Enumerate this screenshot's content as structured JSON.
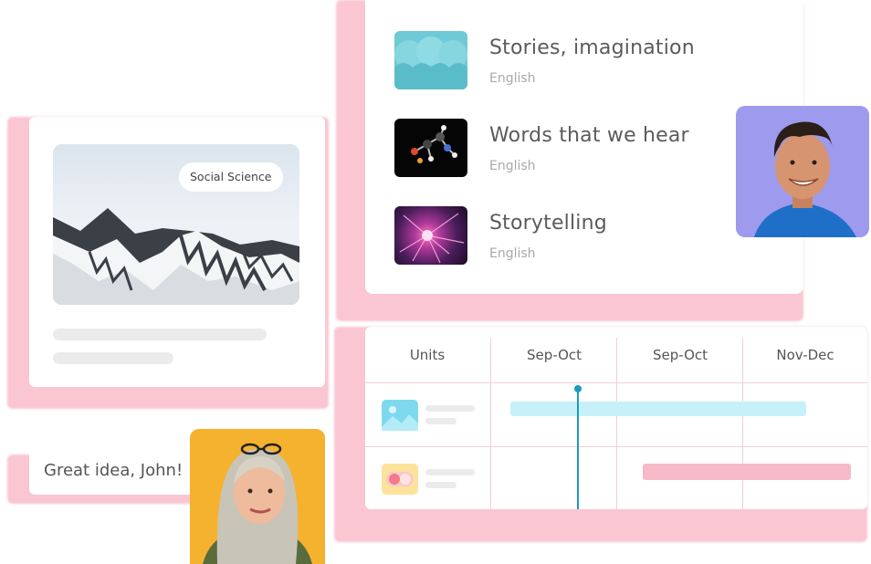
{
  "course_card": {
    "tag": "Social Science"
  },
  "lessons": [
    {
      "title": "Stories, imagination",
      "subject": "English"
    },
    {
      "title": "Words that we hear",
      "subject": "English"
    },
    {
      "title": "Storytelling",
      "subject": "English"
    }
  ],
  "timeline": {
    "columns": [
      "Units",
      "Sep-Oct",
      "Sep-Oct",
      "Nov-Dec"
    ]
  },
  "comment": {
    "text": "Great idea, John! 💡"
  },
  "colors": {
    "glow": "#f9c6d2",
    "bar_blue": "#c6f1fa",
    "bar_pink": "#f7b9c8",
    "marker": "#1a9bc0",
    "man_bg": "#9e9aee",
    "woman_bg": "#f5b22e"
  }
}
